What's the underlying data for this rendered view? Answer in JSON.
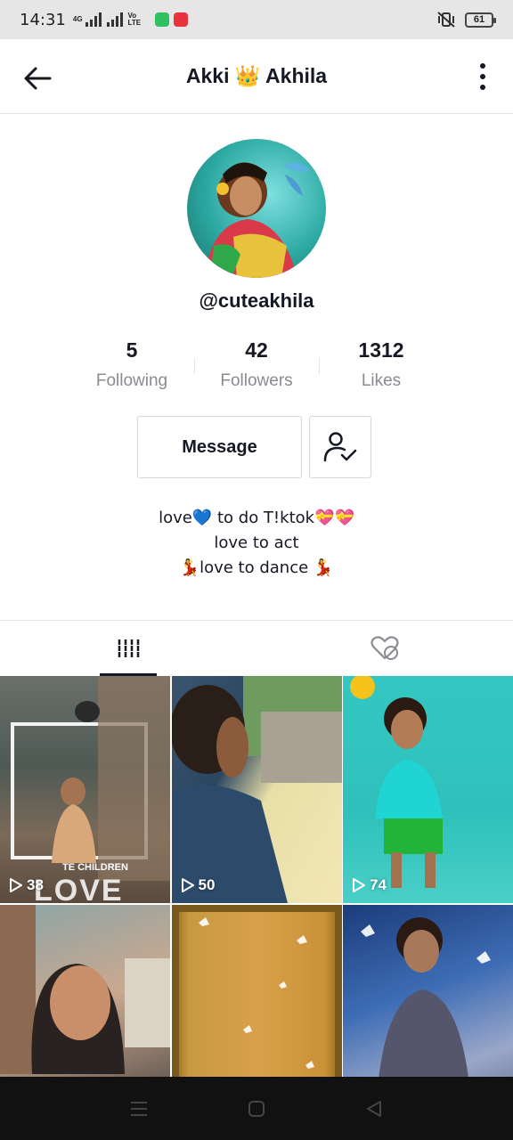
{
  "status_bar": {
    "time": "14:31",
    "network_tag": "4G",
    "volte_tag": "Vo LTE",
    "battery": "61",
    "colors": {
      "app1": "#2fc062",
      "app2": "#e8323c"
    }
  },
  "header": {
    "title": "Akki 👑 Akhila"
  },
  "profile": {
    "handle": "@cuteakhila",
    "stats": [
      {
        "value": "5",
        "label": "Following"
      },
      {
        "value": "42",
        "label": "Followers"
      },
      {
        "value": "1312",
        "label": "Likes"
      }
    ],
    "message_label": "Message",
    "bio_lines": [
      "love💙 to do T!ktok💝💝",
      "love to act",
      "💃love to dance 💃"
    ]
  },
  "tabs": [
    {
      "icon": "videos-grid-icon",
      "active": true
    },
    {
      "icon": "liked-hidden-icon",
      "active": false
    }
  ],
  "videos": [
    {
      "views": "38"
    },
    {
      "views": "50"
    },
    {
      "views": "74"
    },
    {
      "views": ""
    },
    {
      "views": ""
    },
    {
      "views": ""
    }
  ],
  "overlays": {
    "tile1_caption": "TE CHILDREN",
    "tile1_big": "LOVE"
  }
}
